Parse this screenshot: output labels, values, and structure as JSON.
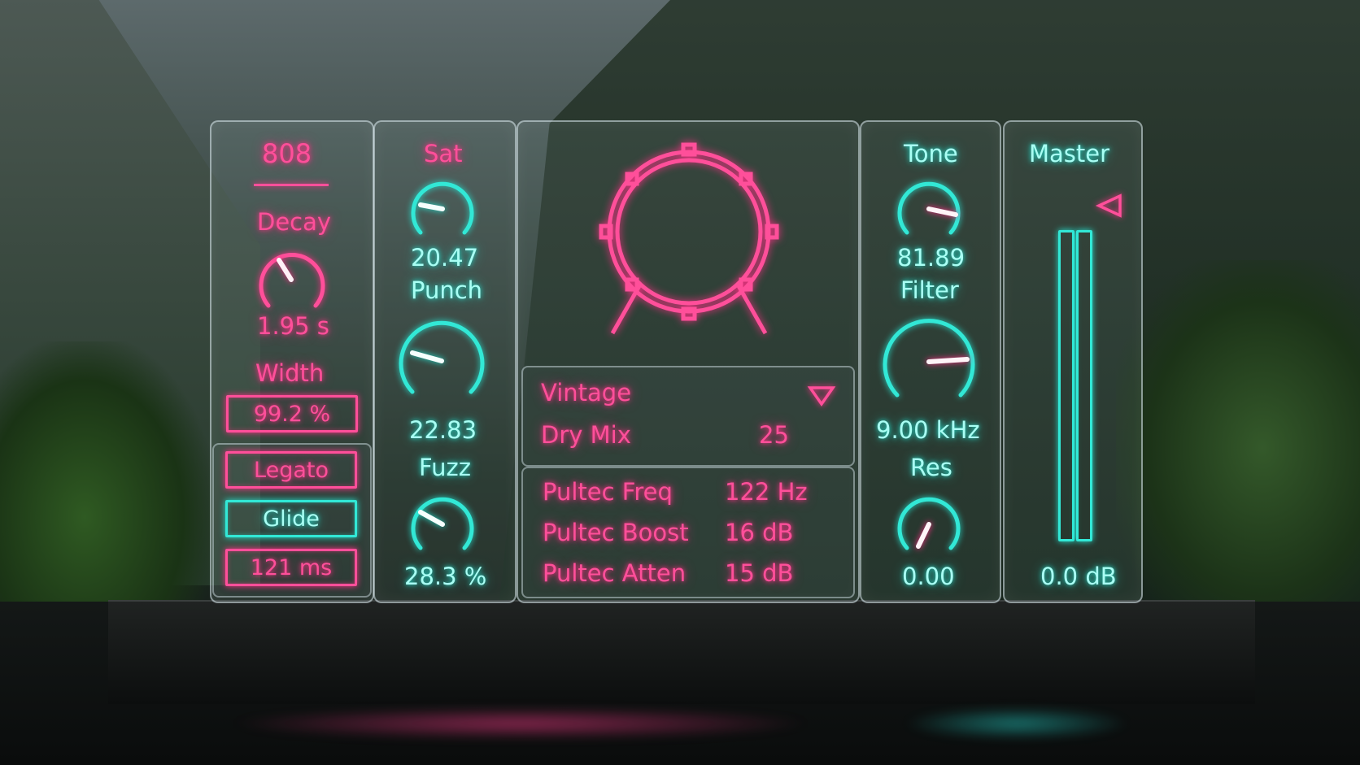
{
  "colors": {
    "pink": "#ff4f9a",
    "cyan": "#32e8d6"
  },
  "kick": {
    "title": "808",
    "decay_label": "Decay",
    "decay_value": "1.95 s",
    "width_label": "Width",
    "width_value": "99.2 %",
    "legato_label": "Legato",
    "glide_label": "Glide",
    "glide_time": "121 ms"
  },
  "drive": {
    "sat_label": "Sat",
    "sat_value": "20.47",
    "punch_label": "Punch",
    "punch_value": "22.83",
    "fuzz_label": "Fuzz",
    "fuzz_value": "28.3 %"
  },
  "center": {
    "drum_icon": "kick-drum-icon",
    "preset_selected": "Vintage",
    "dropdown_icon": "triangle-down-icon",
    "drymix_label": "Dry Mix",
    "drymix_value": "25",
    "pultec": [
      {
        "label": "Pultec Freq",
        "value": "122 Hz"
      },
      {
        "label": "Pultec Boost",
        "value": "16 dB"
      },
      {
        "label": "Pultec Atten",
        "value": "15 dB"
      }
    ]
  },
  "tone": {
    "tone_label": "Tone",
    "tone_value": "81.89",
    "filter_label": "Filter",
    "filter_value": "9.00 kHz",
    "res_label": "Res",
    "res_value": "0.00"
  },
  "master": {
    "label": "Master",
    "value": "0.0 dB",
    "meter_level": 0.93
  }
}
